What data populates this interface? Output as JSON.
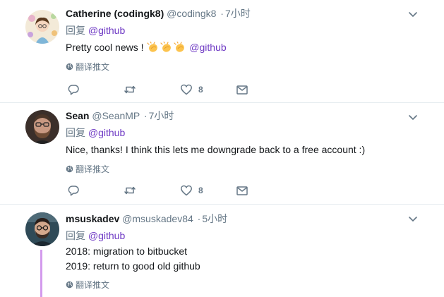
{
  "colors": {
    "accent": "#6f3ac4",
    "muted": "#657786",
    "thread_line": "#d39bed"
  },
  "tweets": [
    {
      "name": "Catherine (codingk8)",
      "handle": "@codingk8",
      "time": "7小时",
      "reply_prefix": "回复",
      "reply_to": "@github",
      "text": "Pretty cool news ! ",
      "text_mention": "@github",
      "translate": "翻译推文",
      "likes": "8"
    },
    {
      "name": "Sean",
      "handle": "@SeanMP",
      "time": "7小时",
      "reply_prefix": "回复",
      "reply_to": "@github",
      "text": "Nice, thanks! I think this lets me downgrade back to a free account :)",
      "translate": "翻译推文",
      "likes": "8"
    },
    {
      "name": "msuskadev",
      "handle": "@msuskadev84",
      "time": "5小时",
      "reply_prefix": "回复",
      "reply_to": "@github",
      "text_lines": [
        "2018: migration to bitbucket",
        "2019: return to good old github"
      ],
      "translate": "翻译推文"
    }
  ],
  "icons": {
    "caret": "chevron-down-icon",
    "reply": "reply-icon",
    "retweet": "retweet-icon",
    "like": "heart-icon",
    "dm": "envelope-icon",
    "globe": "globe-icon",
    "clap": "clapping-hands-emoji"
  }
}
